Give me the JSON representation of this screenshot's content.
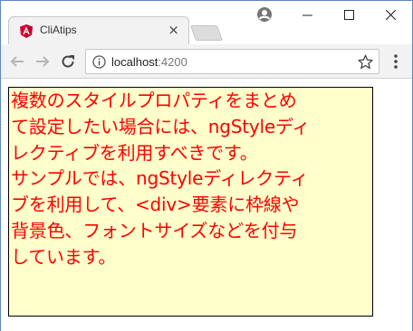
{
  "browser": {
    "tab": {
      "title": "CliAtips",
      "close_glyph": "×",
      "favicon": "angular-icon"
    },
    "window_controls": {
      "minimize": "–",
      "maximize": "☐",
      "close": "✕"
    },
    "toolbar": {
      "back_icon": "back-arrow-icon",
      "forward_icon": "forward-arrow-icon",
      "reload_icon": "reload-icon",
      "url_host": "localhost",
      "url_port": ":4200",
      "bookmark_icon": "star-icon",
      "menu_icon": "kebab-menu-icon"
    }
  },
  "page": {
    "styled_div": {
      "lines": [
        "複数のスタイルプロパティをまとめ",
        "て設定したい場合には、ngStyleディ",
        "レクティブを利用すべきです。",
        "サンプルでは、ngStyleディレクティ",
        "ブを利用して、<div>要素に枠線や",
        "背景色、フォントサイズなどを付与",
        "しています。"
      ],
      "text_color": "#ff0000",
      "background_color": "#ffffcc",
      "border_color": "#000000"
    }
  }
}
